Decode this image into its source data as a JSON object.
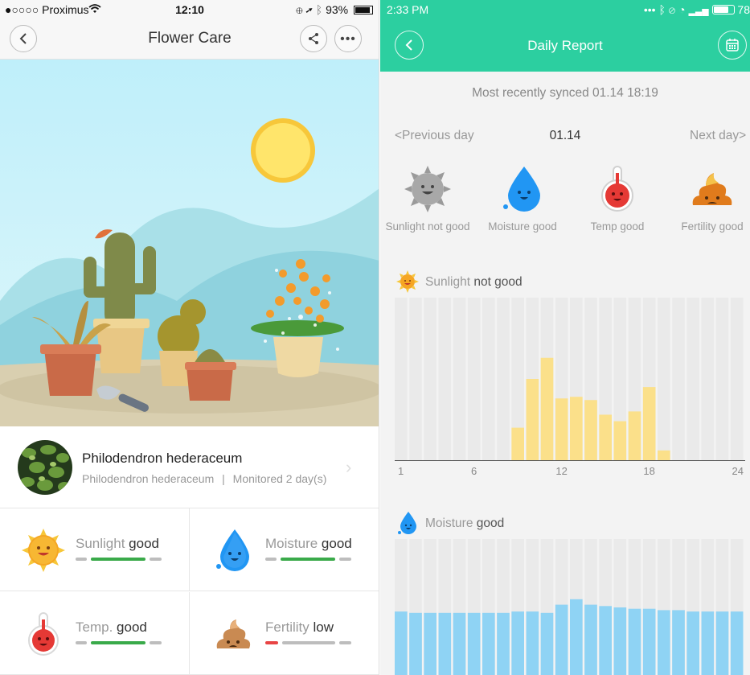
{
  "left_phone": {
    "status_bar": {
      "carrier": "●○○○○ Proximus",
      "time": "12:10",
      "battery": "93%"
    },
    "nav": {
      "title": "Flower Care",
      "back_icon": "back-icon",
      "share_icon": "share-icon",
      "more_icon": "more-icon"
    },
    "plant": {
      "name": "Philodendron hederaceum",
      "latin": "Philodendron hederaceum",
      "separator": "|",
      "monitored": "Monitored 2 day(s)"
    },
    "metrics": [
      {
        "key": "Sunlight",
        "value": "good",
        "icon": "sun-icon",
        "bar_color": "#3aaa4a",
        "level": "normal"
      },
      {
        "key": "Moisture",
        "value": "good",
        "icon": "water-drop-icon",
        "bar_color": "#3aaa4a",
        "level": "normal"
      },
      {
        "key": "Temp.",
        "value": "good",
        "icon": "thermometer-icon",
        "bar_color": "#3aaa4a",
        "level": "normal"
      },
      {
        "key": "Fertility",
        "value": "low",
        "icon": "fertilizer-icon",
        "bar_color": "#e84444",
        "level": "low"
      }
    ]
  },
  "right_phone": {
    "status_bar": {
      "time": "2:33 PM",
      "battery": "78"
    },
    "header": {
      "title": "Daily Report",
      "back_icon": "back-icon",
      "calendar_icon": "calendar-icon",
      "bg_color": "#2ccfa0"
    },
    "synced_text": "Most recently synced 01.14 18:19",
    "day_nav": {
      "prev": "<Previous day",
      "current": "01.14",
      "next": "Next day>"
    },
    "status_icons": [
      {
        "label": "Sunlight not good",
        "icon": "sun-icon"
      },
      {
        "label": "Moisture good",
        "icon": "water-drop-icon"
      },
      {
        "label": "Temp good",
        "icon": "thermometer-icon"
      },
      {
        "label": "Fertility good",
        "icon": "fertilizer-icon"
      }
    ],
    "sunlight_section": {
      "key": "Sunlight",
      "value": "not good"
    },
    "moisture_section": {
      "key": "Moisture",
      "value": "good"
    }
  },
  "chart_data": [
    {
      "type": "bar",
      "title": "Sunlight not good",
      "categories": [
        1,
        2,
        3,
        4,
        5,
        6,
        7,
        8,
        9,
        10,
        11,
        12,
        13,
        14,
        15,
        16,
        17,
        18,
        19,
        20,
        21,
        22,
        23,
        24
      ],
      "xticks": [
        "1",
        "6",
        "12",
        "18",
        "24"
      ],
      "series": [
        {
          "values": [
            0,
            0,
            0,
            0,
            0,
            0,
            0,
            0,
            0.2,
            0.5,
            0.63,
            0.38,
            0.39,
            0.37,
            0.28,
            0.24,
            0.3,
            0.45,
            0.06,
            0,
            0,
            0,
            0,
            0
          ],
          "color": "#fbe08a"
        }
      ],
      "ylim": [
        0,
        1
      ],
      "background_color": "#eaeaea"
    },
    {
      "type": "bar",
      "title": "Moisture good",
      "categories": [
        1,
        2,
        3,
        4,
        5,
        6,
        7,
        8,
        9,
        10,
        11,
        12,
        13,
        14,
        15,
        16,
        17,
        18,
        19,
        20,
        21,
        22,
        23,
        24
      ],
      "series": [
        {
          "values": [
            0.47,
            0.46,
            0.46,
            0.46,
            0.46,
            0.46,
            0.46,
            0.46,
            0.47,
            0.47,
            0.46,
            0.52,
            0.56,
            0.52,
            0.51,
            0.5,
            0.49,
            0.49,
            0.48,
            0.48,
            0.47,
            0.47,
            0.47,
            0.47
          ],
          "color": "#8fd3f4"
        }
      ],
      "ylim": [
        0,
        1
      ],
      "background_color": "#eaeaea"
    }
  ]
}
